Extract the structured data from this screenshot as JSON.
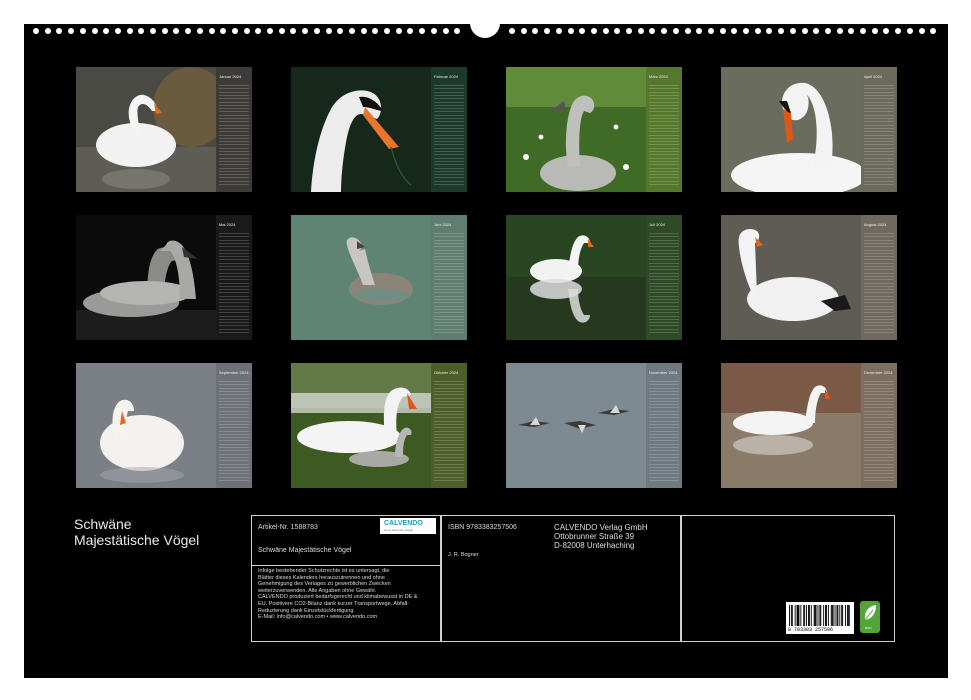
{
  "calendar": {
    "title_line1": "Schwäne",
    "title_line2": "Majestätische Vögel",
    "months": [
      {
        "label": "Januar 2024",
        "scene": "swan-reeds"
      },
      {
        "label": "Februar 2024",
        "scene": "swan-head"
      },
      {
        "label": "März 2024",
        "scene": "cygnet-grass"
      },
      {
        "label": "April 2024",
        "scene": "swan-curved-neck"
      },
      {
        "label": "Mai 2024",
        "scene": "cygnets-pair"
      },
      {
        "label": "Juni 2024",
        "scene": "young-swan-water"
      },
      {
        "label": "Juli 2024",
        "scene": "swan-reflection"
      },
      {
        "label": "August 2024",
        "scene": "swan-preening"
      },
      {
        "label": "September 2024",
        "scene": "swan-resting"
      },
      {
        "label": "Oktober 2024",
        "scene": "swan-with-cygnet"
      },
      {
        "label": "November 2024",
        "scene": "swans-flying"
      },
      {
        "label": "Dezember 2024",
        "scene": "swan-dusk"
      }
    ]
  },
  "info": {
    "article": "Artikel-Nr. 1588783",
    "isbn": "ISBN 9783383257506",
    "publisher_name": "CALVENDO Verlag GmbH",
    "publisher_street": "Ottobrunner Straße 39",
    "publisher_city": "D-82008 Unterhaching",
    "product_title": "Schwäne Majestätische Vögel",
    "author": "J. R. Bogner",
    "legal_lines": [
      "Infolge bestehender Schutzrechte ist es untersagt, die",
      "Blätter dieses Kalenders herauszutrennen und ohne",
      "Genehmigung des Verlages zu gewerblichen Zwecken",
      "weiterzuverwenden. Alle Angaben ohne Gewähr.",
      "CALVENDO produziert bedarfsgerecht und klimabewusst in DE &",
      "EU. Positivere CO2-Bilanz dank kurzer Transportwege. Abfall-",
      "Reduzierung dank Einzelstückfertigung.",
      "E-Mail: info@calvendo.com • www.calvendo.com"
    ],
    "logo_text": "CALVENDO",
    "logo_sub": "kunst kalender design",
    "barcode_number": "9 783383 257506",
    "eco_label": "eco"
  },
  "colors": {
    "sheet": "#000000",
    "border": "#cfcfcf"
  }
}
